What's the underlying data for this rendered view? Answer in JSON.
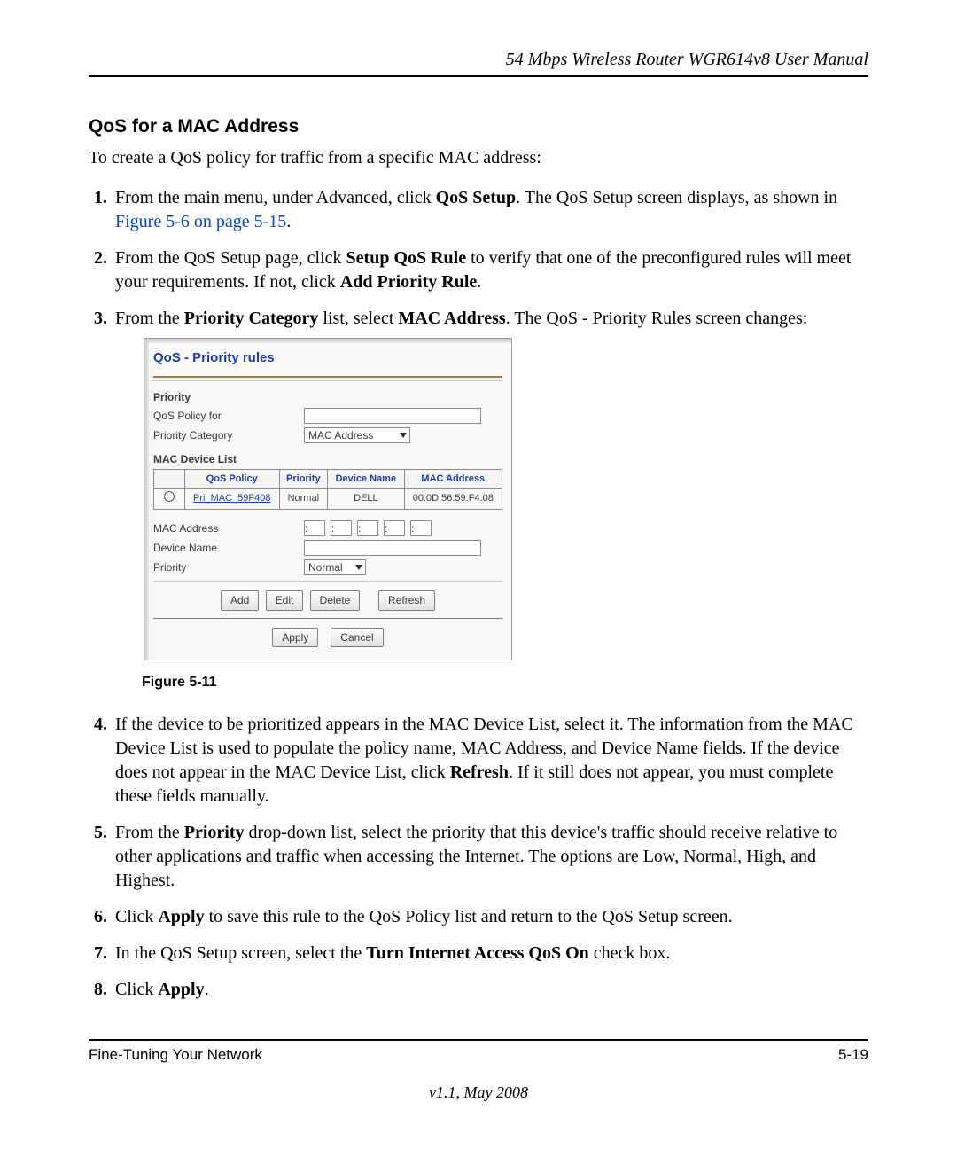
{
  "running_head": "54 Mbps Wireless Router WGR614v8 User Manual",
  "section_title": "QoS for a MAC Address",
  "intro": "To create a QoS policy for traffic from a specific MAC address:",
  "step1_a": "From the main menu, under Advanced, click ",
  "step1_bold": "QoS Setup",
  "step1_b": ". The QoS Setup screen displays, as shown in ",
  "step1_link": "Figure 5-6 on page 5-15",
  "step1_c": ".",
  "step2_a": "From the QoS Setup page, click ",
  "step2_bold1": "Setup QoS Rule",
  "step2_b": " to verify that one of the preconfigured rules will meet your requirements. If not, click ",
  "step2_bold2": "Add Priority Rule",
  "step2_c": ".",
  "step3_a": "From the ",
  "step3_bold1": "Priority Category",
  "step3_b": " list, select ",
  "step3_bold2": "MAC Address",
  "step3_c": ". The QoS - Priority Rules screen changes:",
  "panel_title": "QoS - Priority rules",
  "lbl_priority": "Priority",
  "lbl_qos_policy_for": "QoS Policy for",
  "lbl_priority_category": "Priority Category",
  "sel_priority_category": "MAC Address",
  "lbl_mac_device_list": "MAC Device List",
  "th_qos_policy": "QoS Policy",
  "th_priority": "Priority",
  "th_device_name": "Device Name",
  "th_mac_address": "MAC Address",
  "row_policy": "Pri_MAC_59F408",
  "row_priority": "Normal",
  "row_device": "DELL",
  "row_mac": "00:0D:56:59:F4:08",
  "lbl_mac_address": "MAC Address",
  "lbl_device_name": "Device Name",
  "lbl_priority2": "Priority",
  "sel_priority2": "Normal",
  "btn_add": "Add",
  "btn_edit": "Edit",
  "btn_delete": "Delete",
  "btn_refresh": "Refresh",
  "btn_apply": "Apply",
  "btn_cancel": "Cancel",
  "figure_caption": "Figure 5-11",
  "step4_a": "If the device to be prioritized appears in the MAC Device List, select it. The information from the MAC Device List is used to populate the policy name, MAC Address, and Device Name fields. If the device does not appear in the MAC Device List, click ",
  "step4_bold": "Refresh",
  "step4_b": ". If it still does not appear, you must complete these fields manually.",
  "step5_a": "From the ",
  "step5_bold": "Priority",
  "step5_b": " drop-down list, select the priority that this device's traffic should receive relative to other applications and traffic when accessing the Internet. The options are Low, Normal, High, and Highest.",
  "step6_a": "Click ",
  "step6_bold": "Apply",
  "step6_b": " to save this rule to the QoS Policy list and return to the QoS Setup screen.",
  "step7_a": "In the QoS Setup screen, select the ",
  "step7_bold": "Turn Internet Access QoS On",
  "step7_b": " check box.",
  "step8_a": "Click ",
  "step8_bold": "Apply",
  "step8_b": ".",
  "footer_left": "Fine-Tuning Your Network",
  "footer_right": "5-19",
  "version": "v1.1, May 2008"
}
